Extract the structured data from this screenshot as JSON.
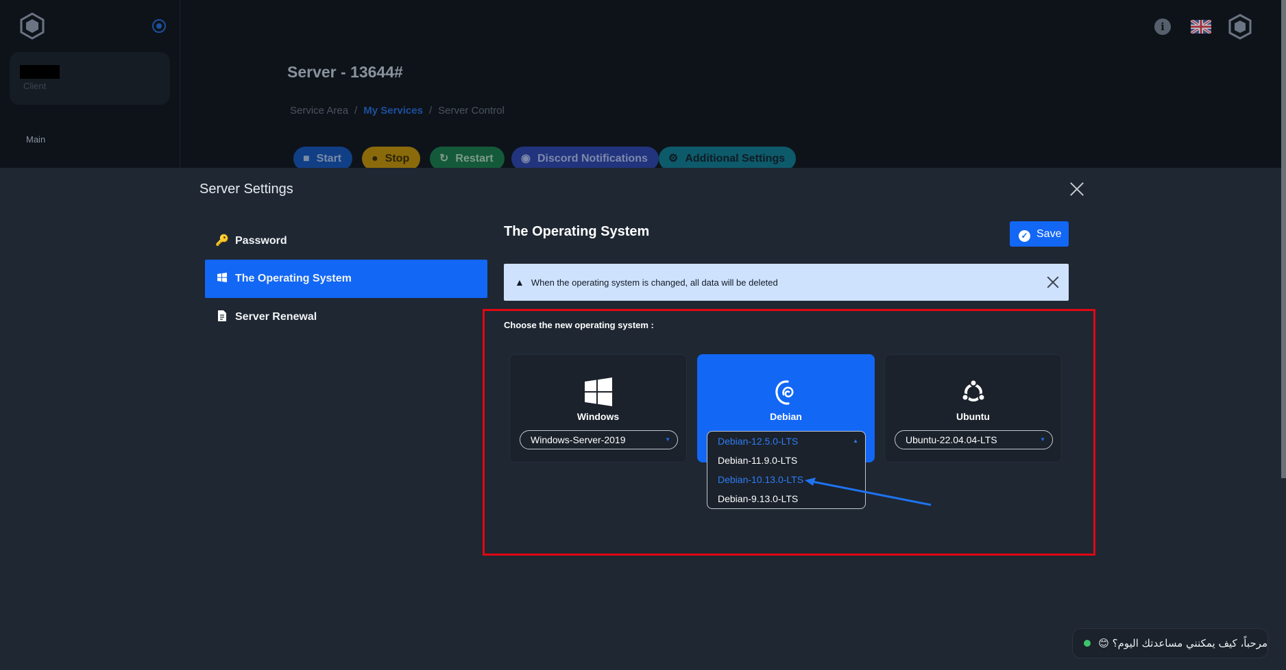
{
  "app": {
    "sidebar": {
      "profile_role": "Client",
      "nav_main": "Main"
    },
    "page_title": "Server - 13644#",
    "breadcrumb": [
      "Service Area",
      "My Services",
      "Server Control"
    ],
    "actions": {
      "start": "Start",
      "stop": "Stop",
      "restart": "Restart",
      "discord": "Discord Notifications",
      "settings": "Additional Settings"
    },
    "top_icons": [
      "info-icon",
      "uk-flag-icon",
      "account-logo-icon"
    ]
  },
  "modal": {
    "title": "Server Settings",
    "side_menu": [
      {
        "label": "Password",
        "icon": "key-icon"
      },
      {
        "label": "The Operating System",
        "icon": "windows-icon",
        "active": true
      },
      {
        "label": "Server Renewal",
        "icon": "document-icon"
      }
    ],
    "section_title": "The Operating System",
    "save_label": "Save",
    "alert_text": "When the operating system is changed, all data will be deleted",
    "choose_label": "Choose the new operating system :",
    "os_options": [
      {
        "name": "Windows",
        "selected_version": "Windows-Server-2019",
        "selected": false
      },
      {
        "name": "Debian",
        "selected_version": "Debian-12.5.0-LTS",
        "selected": true
      },
      {
        "name": "Ubuntu",
        "selected_version": "Ubuntu-22.04.04-LTS",
        "selected": false
      }
    ],
    "debian_dropdown": [
      "Debian-12.5.0-LTS",
      "Debian-11.9.0-LTS",
      "Debian-10.13.0-LTS",
      "Debian-9.13.0-LTS"
    ]
  },
  "chat": {
    "greeting": "مرحباً، كيف يمكنني مساعدتك اليوم؟ 😊"
  },
  "colors": {
    "accent": "#1267f5",
    "highlight_frame": "#e30613",
    "background": "#1f2732"
  }
}
